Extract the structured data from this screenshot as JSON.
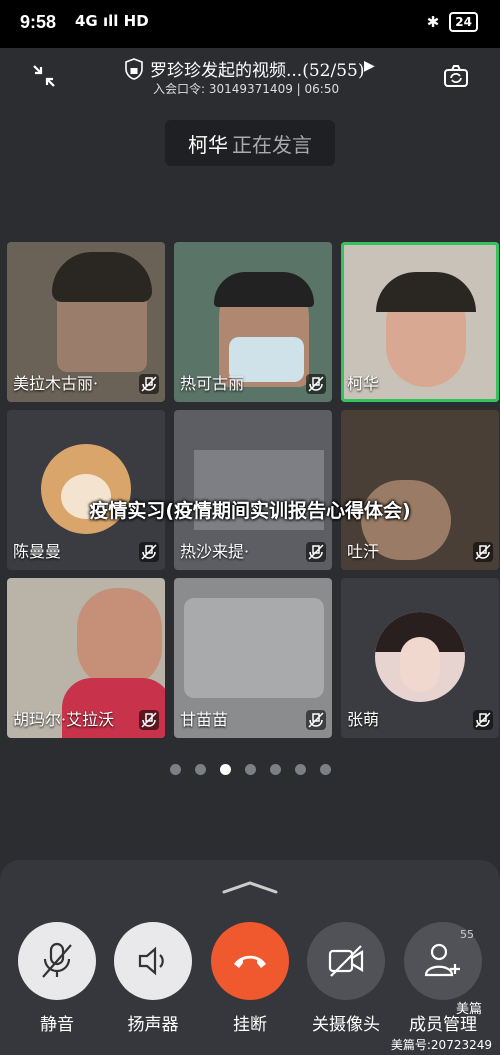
{
  "status_bar": {
    "time": "9:58",
    "network": "4G ıll",
    "wifi": "HD",
    "battery": "24"
  },
  "header": {
    "meeting_title": "罗珍珍发起的视频...(52/55)",
    "meeting_info": "入会口令: 30149371409 | 06:50"
  },
  "speaking": {
    "name": "柯华",
    "status": "正在发言"
  },
  "tiles": [
    {
      "name": "美拉木古丽·"
    },
    {
      "name": "热可古丽"
    },
    {
      "name": "柯华"
    },
    {
      "name": "陈曼曼"
    },
    {
      "name": "热沙来提·"
    },
    {
      "name": "吐汗"
    },
    {
      "name": "胡玛尔·艾拉沃"
    },
    {
      "name": "甘苗苗"
    },
    {
      "name": "张萌"
    }
  ],
  "overlay_title": "疫情实习(疫情期间实训报告心得体会)",
  "controls": [
    {
      "label": "静音"
    },
    {
      "label": "扬声器"
    },
    {
      "label": "挂断"
    },
    {
      "label": "关摄像头"
    },
    {
      "label": "成员管理"
    }
  ],
  "member_count": "55",
  "watermark": {
    "brand": "美篇",
    "id": "美篇号:20723249"
  },
  "colors": {
    "hangup": "#f0582d",
    "active_border": "#35c25d",
    "button": "#e9e9eb"
  }
}
